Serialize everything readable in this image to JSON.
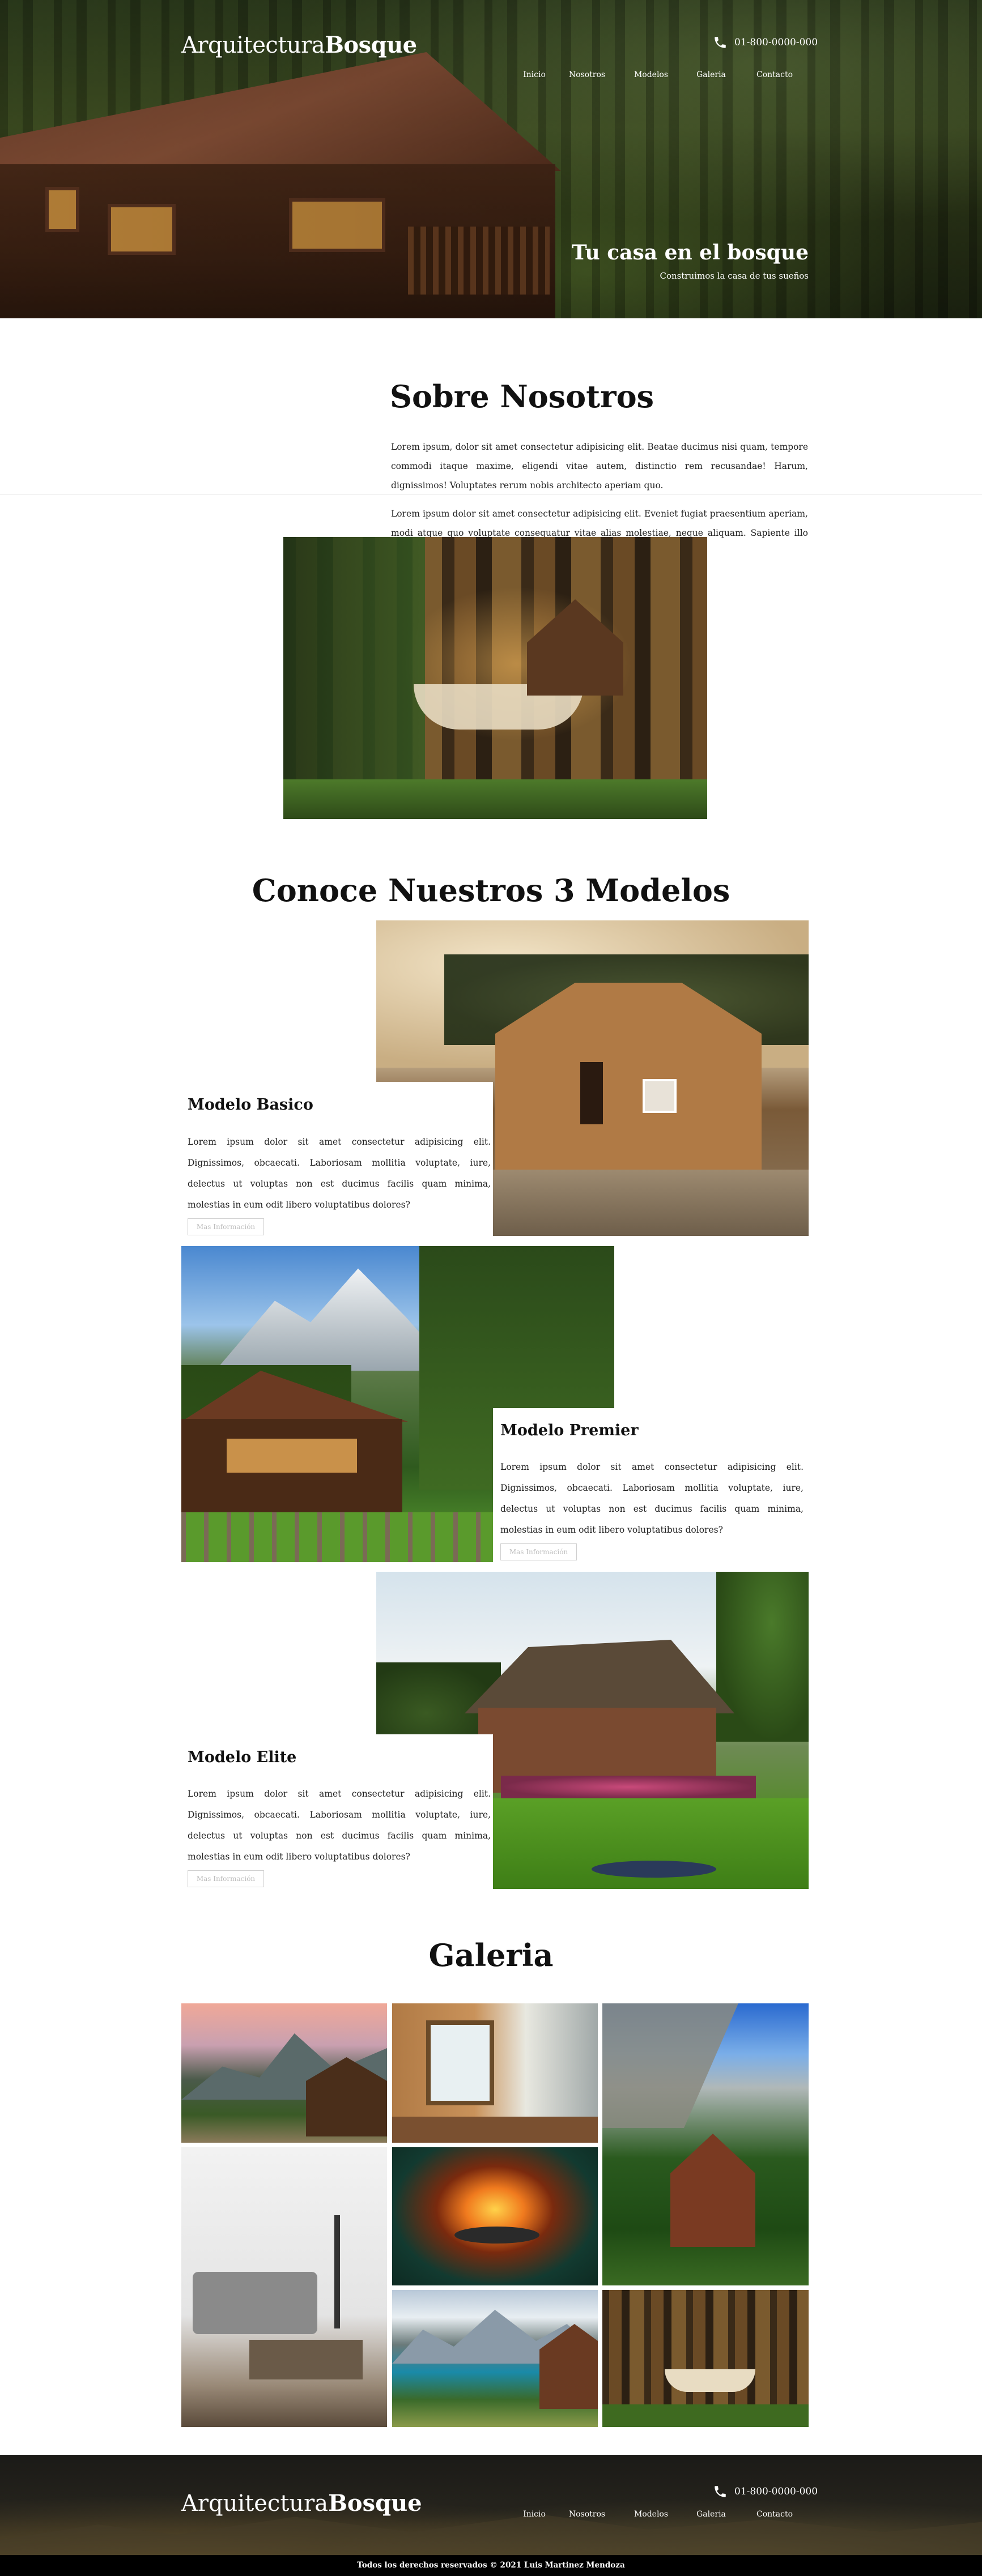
{
  "site": {
    "brand_regular": "Arquitectura",
    "brand_bold": "Bosque",
    "phone": "01-800-0000-000"
  },
  "nav": {
    "items": [
      {
        "label": "Inicio"
      },
      {
        "label": "Nosotros"
      },
      {
        "label": "Modelos"
      },
      {
        "label": "Galeria"
      },
      {
        "label": "Contacto"
      }
    ]
  },
  "hero": {
    "title": "Tu casa en el bosque",
    "subtitle": "Construimos la casa de tus sueños"
  },
  "about": {
    "title": "Sobre Nosotros",
    "paragraph_1": "Lorem ipsum, dolor sit amet consectetur adipisicing elit. Beatae ducimus nisi quam, tempore commodi itaque maxime, eligendi vitae autem, distinctio rem recusandae! Harum, dignissimos! Voluptates rerum nobis architecto aperiam quo.",
    "paragraph_2": "Lorem ipsum dolor sit amet consectetur adipisicing elit. Eveniet fugiat praesentium aperiam, modi atque quo voluptate consequatur vitae alias molestiae, neque aliquam. Sapiente illo nobis facere aspernatur, porro sunt sint?"
  },
  "models": {
    "title": "Conoce Nuestros 3 Modelos",
    "items": [
      {
        "name": "Modelo Basico",
        "description": "Lorem ipsum dolor sit amet consectetur adipisicing elit. Dignissimos, obcaecati. Laboriosam mollitia voluptate, iure, delectus ut voluptas non est ducimus facilis quam minima, molestias in eum odit libero voluptatibus dolores?",
        "button": "Mas Información"
      },
      {
        "name": "Modelo Premier",
        "description": "Lorem ipsum dolor sit amet consectetur adipisicing elit. Dignissimos, obcaecati. Laboriosam mollitia voluptate, iure, delectus ut voluptas non est ducimus facilis quam minima, molestias in eum odit libero voluptatibus dolores?",
        "button": "Mas Información"
      },
      {
        "name": "Modelo Elite",
        "description": "Lorem ipsum dolor sit amet consectetur adipisicing elit. Dignissimos, obcaecati. Laboriosam mollitia voluptate, iure, delectus ut voluptas non est ducimus facilis quam minima, molestias in eum odit libero voluptatibus dolores?",
        "button": "Mas Información"
      }
    ]
  },
  "gallery": {
    "title": "Galeria"
  },
  "footer": {
    "copyright": "Todos los derechos reservados © 2021 Luis Martinez Mendoza"
  },
  "colors": {
    "text": "#111111",
    "button_border": "#cfcfcf",
    "footer_bar": "#000000",
    "hero_overlay_text": "#ffffff"
  }
}
